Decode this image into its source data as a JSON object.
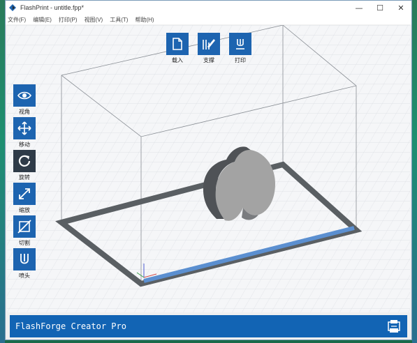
{
  "window": {
    "title": "FlashPrint - untitle.fpp*",
    "minimize_glyph": "—",
    "maximize_glyph": "☐",
    "close_glyph": "✕"
  },
  "menu": [
    "文件(F)",
    "编辑(E)",
    "打印(P)",
    "视图(V)",
    "工具(T)",
    "帮助(H)"
  ],
  "top_tools": [
    {
      "label": "载入",
      "icon": "file-load-icon"
    },
    {
      "label": "支撑",
      "icon": "support-icon"
    },
    {
      "label": "打印",
      "icon": "print-icon"
    }
  ],
  "side_tools": [
    {
      "label": "视角",
      "icon": "eye-icon"
    },
    {
      "label": "移动",
      "icon": "move-icon"
    },
    {
      "label": "旋转",
      "icon": "rotate-icon",
      "active": true
    },
    {
      "label": "缩放",
      "icon": "scale-icon"
    },
    {
      "label": "切割",
      "icon": "cut-icon"
    },
    {
      "label": "喷头",
      "icon": "extruder-icon"
    }
  ],
  "status": {
    "printer_name": "FlashForge Creator Pro"
  },
  "colors": {
    "accent": "#1d64b0",
    "status_bar": "#1264b4",
    "active_tool": "#2f3b48",
    "model": "#9a9a9a",
    "build_plate_frame": "#5a5f63",
    "build_plate_front_edge": "#5b8fd0"
  }
}
